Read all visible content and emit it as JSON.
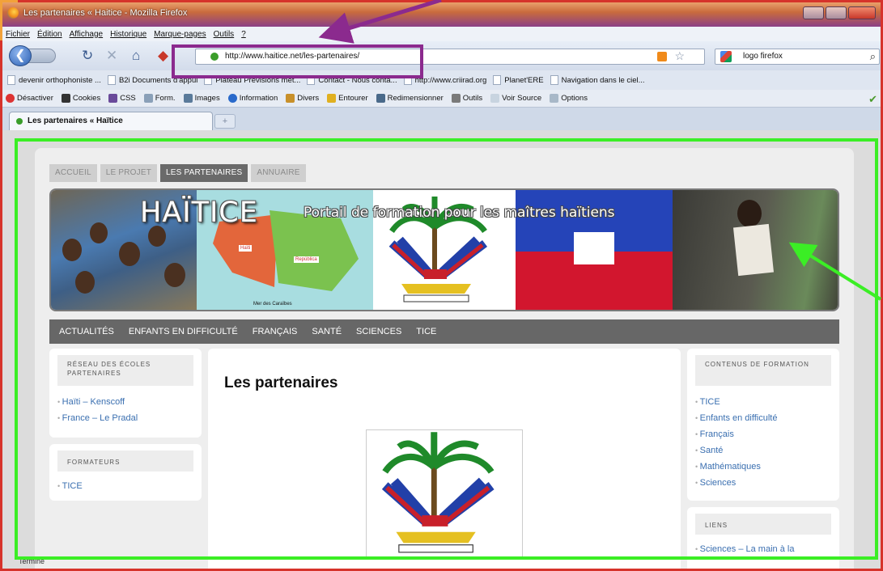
{
  "window": {
    "title": "Les partenaires « Haitice - Mozilla Firefox"
  },
  "menu": [
    "Fichier",
    "Édition",
    "Affichage",
    "Historique",
    "Marque-pages",
    "Outils",
    "?"
  ],
  "navbar": {
    "url": "http://www.haitice.net/les-partenaires/",
    "search_value": "logo firefox"
  },
  "bookmarks": [
    "devenir orthophoniste ...",
    "B2i Documents d'appui",
    "Plateau Prévisions mét...",
    "Contact - Nous conta...",
    "http://www.criirad.org",
    "Planet'ERE",
    "Navigation dans le ciel..."
  ],
  "devtoolbar": [
    "Désactiver",
    "Cookies",
    "CSS",
    "Form.",
    "Images",
    "Information",
    "Divers",
    "Entourer",
    "Redimensionner",
    "Outils",
    "Voir Source",
    "Options"
  ],
  "browser_tab": {
    "label": "Les partenaires « Haïtice",
    "new_tab": "+"
  },
  "site": {
    "tabs": [
      "ACCUEIL",
      "LE PROJET",
      "LES PARTENAIRES",
      "ANNUAIRE"
    ],
    "active_tab": "LES PARTENAIRES",
    "brand": "HAÏTICE",
    "tagline": "Portail de formation pour les maîtres haïtiens",
    "map_labels": {
      "haiti": "Haïti",
      "republica": "República",
      "sea": "Mer des Caraïbes"
    },
    "categories": [
      "ACTUALITÉS",
      "ENFANTS EN DIFFICULTÉ",
      "FRANÇAIS",
      "SANTÉ",
      "SCIENCES",
      "TICE"
    ],
    "left_widgets": [
      {
        "title": "RÉSEAU DES ÉCOLES PARTENAIRES",
        "items": [
          "Haïti – Kenscoff",
          "France – Le Pradal"
        ]
      },
      {
        "title": "FORMATEURS",
        "items": [
          "TICE"
        ]
      }
    ],
    "main": {
      "heading": "Les partenaires"
    },
    "right_widgets": [
      {
        "title": "CONTENUS DE FORMATION",
        "items": [
          "TICE",
          "Enfants en difficulté",
          "Français",
          "Santé",
          "Mathématiques",
          "Sciences"
        ]
      },
      {
        "title": "LIENS",
        "items": [
          "Sciences – La main à la"
        ]
      }
    ]
  },
  "status": "Terminé",
  "colors": {
    "annotation_green": "#3bee25",
    "annotation_purple": "#8b2a8e",
    "frame_red": "#d6332b"
  }
}
